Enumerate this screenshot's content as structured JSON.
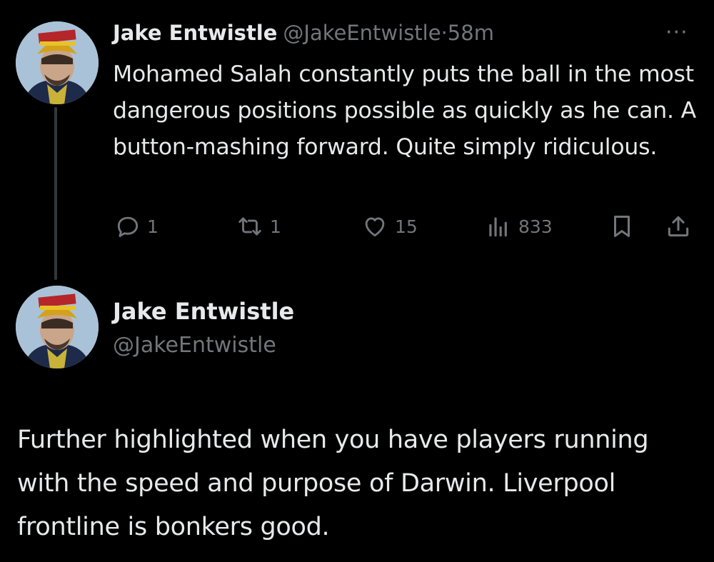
{
  "tweet1": {
    "author_name": "Jake Entwistle",
    "author_handle": "@JakeEntwistle",
    "separator": "·",
    "time": "58m",
    "more_label": "···",
    "text": "Mohamed Salah constantly puts the ball in the most dangerous positions possible as quickly as he can. A button-mashing forward. Quite simply ridiculous.",
    "actions": {
      "replies": "1",
      "retweets": "1",
      "likes": "15",
      "views": "833"
    }
  },
  "tweet2": {
    "author_name": "Jake Entwistle",
    "author_handle": "@JakeEntwistle",
    "text": "Further highlighted when you have players running with the speed and purpose of Darwin. Liverpool frontline is bonkers good."
  },
  "colors": {
    "background": "#000000",
    "text": "#e7e9ea",
    "muted": "#71767b",
    "thread_line": "#333639"
  },
  "icons": [
    "reply-icon",
    "retweet-icon",
    "like-icon",
    "views-icon",
    "bookmark-icon",
    "share-icon",
    "more-icon"
  ]
}
